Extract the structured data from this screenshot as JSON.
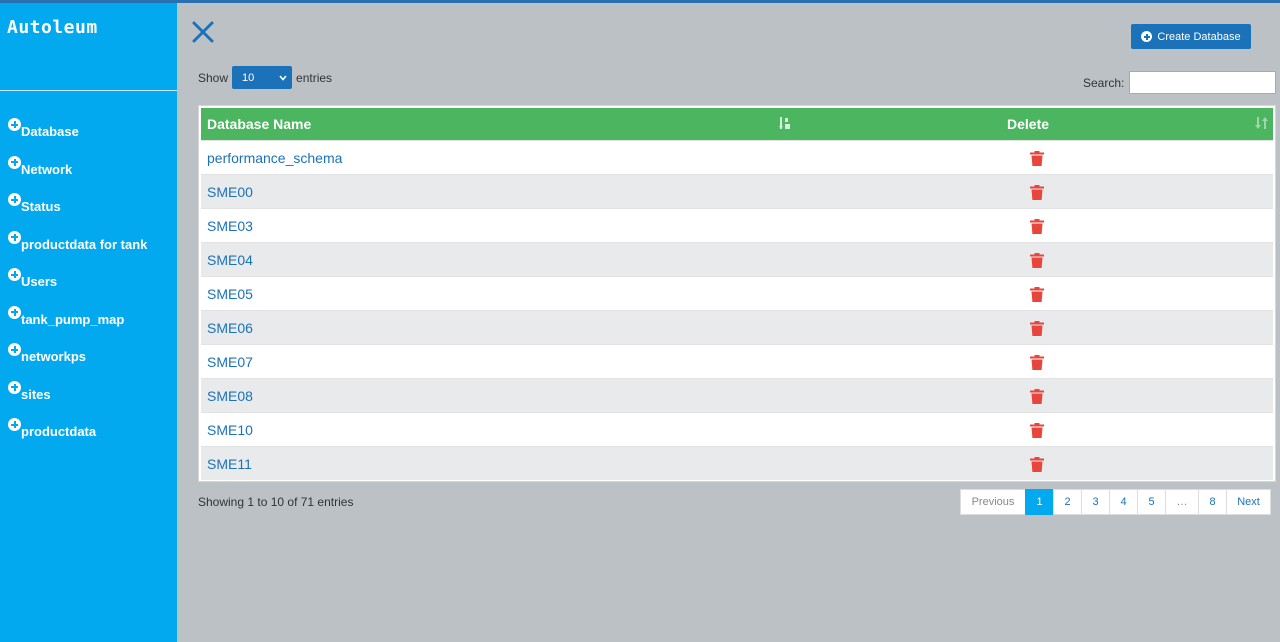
{
  "app": {
    "title": "Autoleum"
  },
  "sidebar": {
    "items": [
      {
        "label": "Database"
      },
      {
        "label": "Network"
      },
      {
        "label": "Status"
      },
      {
        "label": "productdata for tank"
      },
      {
        "label": "Users"
      },
      {
        "label": "tank_pump_map"
      },
      {
        "label": "networkps"
      },
      {
        "label": "sites"
      },
      {
        "label": "productdata"
      }
    ]
  },
  "toolbar": {
    "create_label": "Create Database"
  },
  "controls": {
    "show_label": "Show",
    "length_value": "10",
    "entries_label": "entries",
    "search_label": "Search:",
    "search_value": ""
  },
  "table": {
    "columns": [
      "Database Name",
      "Delete"
    ],
    "rows": [
      "performance_schema",
      "SME00",
      "SME03",
      "SME04",
      "SME05",
      "SME06",
      "SME07",
      "SME08",
      "SME10",
      "SME11"
    ]
  },
  "footer": {
    "info": "Showing 1 to 10 of 71 entries",
    "pagination": {
      "previous": "Previous",
      "pages": [
        "1",
        "2",
        "3",
        "4",
        "5",
        "…",
        "8"
      ],
      "next": "Next",
      "active": "1"
    }
  },
  "colors": {
    "sidebar": "#03a9ef",
    "header": "#4cb560",
    "primary_button": "#1b72b8",
    "delete_icon": "#e8453c",
    "background": "#bcc1c6"
  }
}
